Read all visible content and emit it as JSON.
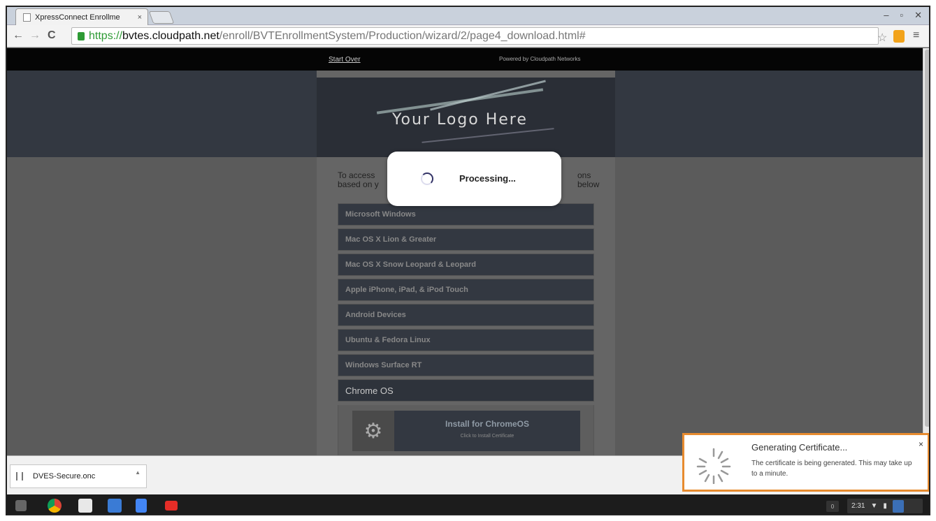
{
  "browser": {
    "tab_title": "XpressConnect Enrollme",
    "tab_close": "×",
    "window_controls": {
      "minimize": "–",
      "restore": "▫",
      "close": "✕"
    },
    "back": "←",
    "forward": "→",
    "reload": "C",
    "url": {
      "scheme": "https://",
      "host": "bvtes.cloudpath.net",
      "path": "/enroll/BVTEnrollmentSystem/Production/wizard/2/page4_download.html#"
    },
    "star": "☆",
    "menu": "≡"
  },
  "page": {
    "top_links": {
      "start_over": "Start Over",
      "powered_by": "Powered by Cloudpath Networks"
    },
    "logo_text": "Your Logo Here",
    "intro_left": "To access",
    "intro_left_2": "based on y",
    "intro_right": "ons below",
    "os_options": [
      "Microsoft Windows",
      "Mac OS X Lion & Greater",
      "Mac OS X Snow Leopard & Leopard",
      "Apple iPhone, iPad, & iPod Touch",
      "Android Devices",
      "Ubuntu & Fedora Linux",
      "Windows Surface RT",
      "Chrome OS"
    ],
    "install": {
      "title": "Install for ChromeOS",
      "subtitle": "Click to Install Certificate",
      "gear_icon": "⚙"
    }
  },
  "modal": {
    "text": "Processing..."
  },
  "download_shelf": {
    "filename": "DVES-Secure.onc",
    "arrow": "▲"
  },
  "notification": {
    "title": "Generating Certificate...",
    "body": "The certificate is being generated.  This may take up to a minute.",
    "close": "×"
  },
  "taskbar": {
    "notification_count": "0",
    "time": "2:31",
    "wifi_icon": "▼",
    "battery_icon": "▮"
  },
  "colors": {
    "notification_border": "#e78b2f",
    "secure_green": "#2e9b35",
    "banner": "#333841"
  }
}
